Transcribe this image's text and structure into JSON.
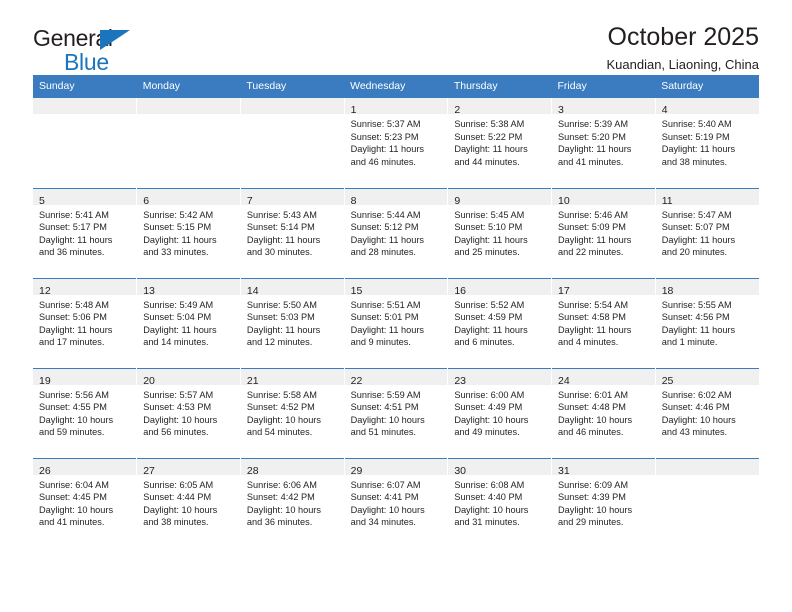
{
  "brand": {
    "line1": "General",
    "line2": "Blue",
    "triangle_color": "#1b75bc"
  },
  "header": {
    "title": "October 2025",
    "subtitle": "Kuandian, Liaoning, China"
  },
  "theme": {
    "header_blue": "#3b7cc0",
    "daynum_band": "#f0f0f0",
    "text": "#231f20",
    "brand_blue": "#1b75bc"
  },
  "weekday_headers": [
    "Sunday",
    "Monday",
    "Tuesday",
    "Wednesday",
    "Thursday",
    "Friday",
    "Saturday"
  ],
  "weeks": [
    [
      {
        "day": "",
        "sunrise": "",
        "sunset": "",
        "daylight_1": "",
        "daylight_2": ""
      },
      {
        "day": "",
        "sunrise": "",
        "sunset": "",
        "daylight_1": "",
        "daylight_2": ""
      },
      {
        "day": "",
        "sunrise": "",
        "sunset": "",
        "daylight_1": "",
        "daylight_2": ""
      },
      {
        "day": "1",
        "sunrise": "Sunrise: 5:37 AM",
        "sunset": "Sunset: 5:23 PM",
        "daylight_1": "Daylight: 11 hours",
        "daylight_2": "and 46 minutes."
      },
      {
        "day": "2",
        "sunrise": "Sunrise: 5:38 AM",
        "sunset": "Sunset: 5:22 PM",
        "daylight_1": "Daylight: 11 hours",
        "daylight_2": "and 44 minutes."
      },
      {
        "day": "3",
        "sunrise": "Sunrise: 5:39 AM",
        "sunset": "Sunset: 5:20 PM",
        "daylight_1": "Daylight: 11 hours",
        "daylight_2": "and 41 minutes."
      },
      {
        "day": "4",
        "sunrise": "Sunrise: 5:40 AM",
        "sunset": "Sunset: 5:19 PM",
        "daylight_1": "Daylight: 11 hours",
        "daylight_2": "and 38 minutes."
      }
    ],
    [
      {
        "day": "5",
        "sunrise": "Sunrise: 5:41 AM",
        "sunset": "Sunset: 5:17 PM",
        "daylight_1": "Daylight: 11 hours",
        "daylight_2": "and 36 minutes."
      },
      {
        "day": "6",
        "sunrise": "Sunrise: 5:42 AM",
        "sunset": "Sunset: 5:15 PM",
        "daylight_1": "Daylight: 11 hours",
        "daylight_2": "and 33 minutes."
      },
      {
        "day": "7",
        "sunrise": "Sunrise: 5:43 AM",
        "sunset": "Sunset: 5:14 PM",
        "daylight_1": "Daylight: 11 hours",
        "daylight_2": "and 30 minutes."
      },
      {
        "day": "8",
        "sunrise": "Sunrise: 5:44 AM",
        "sunset": "Sunset: 5:12 PM",
        "daylight_1": "Daylight: 11 hours",
        "daylight_2": "and 28 minutes."
      },
      {
        "day": "9",
        "sunrise": "Sunrise: 5:45 AM",
        "sunset": "Sunset: 5:10 PM",
        "daylight_1": "Daylight: 11 hours",
        "daylight_2": "and 25 minutes."
      },
      {
        "day": "10",
        "sunrise": "Sunrise: 5:46 AM",
        "sunset": "Sunset: 5:09 PM",
        "daylight_1": "Daylight: 11 hours",
        "daylight_2": "and 22 minutes."
      },
      {
        "day": "11",
        "sunrise": "Sunrise: 5:47 AM",
        "sunset": "Sunset: 5:07 PM",
        "daylight_1": "Daylight: 11 hours",
        "daylight_2": "and 20 minutes."
      }
    ],
    [
      {
        "day": "12",
        "sunrise": "Sunrise: 5:48 AM",
        "sunset": "Sunset: 5:06 PM",
        "daylight_1": "Daylight: 11 hours",
        "daylight_2": "and 17 minutes."
      },
      {
        "day": "13",
        "sunrise": "Sunrise: 5:49 AM",
        "sunset": "Sunset: 5:04 PM",
        "daylight_1": "Daylight: 11 hours",
        "daylight_2": "and 14 minutes."
      },
      {
        "day": "14",
        "sunrise": "Sunrise: 5:50 AM",
        "sunset": "Sunset: 5:03 PM",
        "daylight_1": "Daylight: 11 hours",
        "daylight_2": "and 12 minutes."
      },
      {
        "day": "15",
        "sunrise": "Sunrise: 5:51 AM",
        "sunset": "Sunset: 5:01 PM",
        "daylight_1": "Daylight: 11 hours",
        "daylight_2": "and 9 minutes."
      },
      {
        "day": "16",
        "sunrise": "Sunrise: 5:52 AM",
        "sunset": "Sunset: 4:59 PM",
        "daylight_1": "Daylight: 11 hours",
        "daylight_2": "and 6 minutes."
      },
      {
        "day": "17",
        "sunrise": "Sunrise: 5:54 AM",
        "sunset": "Sunset: 4:58 PM",
        "daylight_1": "Daylight: 11 hours",
        "daylight_2": "and 4 minutes."
      },
      {
        "day": "18",
        "sunrise": "Sunrise: 5:55 AM",
        "sunset": "Sunset: 4:56 PM",
        "daylight_1": "Daylight: 11 hours",
        "daylight_2": "and 1 minute."
      }
    ],
    [
      {
        "day": "19",
        "sunrise": "Sunrise: 5:56 AM",
        "sunset": "Sunset: 4:55 PM",
        "daylight_1": "Daylight: 10 hours",
        "daylight_2": "and 59 minutes."
      },
      {
        "day": "20",
        "sunrise": "Sunrise: 5:57 AM",
        "sunset": "Sunset: 4:53 PM",
        "daylight_1": "Daylight: 10 hours",
        "daylight_2": "and 56 minutes."
      },
      {
        "day": "21",
        "sunrise": "Sunrise: 5:58 AM",
        "sunset": "Sunset: 4:52 PM",
        "daylight_1": "Daylight: 10 hours",
        "daylight_2": "and 54 minutes."
      },
      {
        "day": "22",
        "sunrise": "Sunrise: 5:59 AM",
        "sunset": "Sunset: 4:51 PM",
        "daylight_1": "Daylight: 10 hours",
        "daylight_2": "and 51 minutes."
      },
      {
        "day": "23",
        "sunrise": "Sunrise: 6:00 AM",
        "sunset": "Sunset: 4:49 PM",
        "daylight_1": "Daylight: 10 hours",
        "daylight_2": "and 49 minutes."
      },
      {
        "day": "24",
        "sunrise": "Sunrise: 6:01 AM",
        "sunset": "Sunset: 4:48 PM",
        "daylight_1": "Daylight: 10 hours",
        "daylight_2": "and 46 minutes."
      },
      {
        "day": "25",
        "sunrise": "Sunrise: 6:02 AM",
        "sunset": "Sunset: 4:46 PM",
        "daylight_1": "Daylight: 10 hours",
        "daylight_2": "and 43 minutes."
      }
    ],
    [
      {
        "day": "26",
        "sunrise": "Sunrise: 6:04 AM",
        "sunset": "Sunset: 4:45 PM",
        "daylight_1": "Daylight: 10 hours",
        "daylight_2": "and 41 minutes."
      },
      {
        "day": "27",
        "sunrise": "Sunrise: 6:05 AM",
        "sunset": "Sunset: 4:44 PM",
        "daylight_1": "Daylight: 10 hours",
        "daylight_2": "and 38 minutes."
      },
      {
        "day": "28",
        "sunrise": "Sunrise: 6:06 AM",
        "sunset": "Sunset: 4:42 PM",
        "daylight_1": "Daylight: 10 hours",
        "daylight_2": "and 36 minutes."
      },
      {
        "day": "29",
        "sunrise": "Sunrise: 6:07 AM",
        "sunset": "Sunset: 4:41 PM",
        "daylight_1": "Daylight: 10 hours",
        "daylight_2": "and 34 minutes."
      },
      {
        "day": "30",
        "sunrise": "Sunrise: 6:08 AM",
        "sunset": "Sunset: 4:40 PM",
        "daylight_1": "Daylight: 10 hours",
        "daylight_2": "and 31 minutes."
      },
      {
        "day": "31",
        "sunrise": "Sunrise: 6:09 AM",
        "sunset": "Sunset: 4:39 PM",
        "daylight_1": "Daylight: 10 hours",
        "daylight_2": "and 29 minutes."
      },
      {
        "day": "",
        "sunrise": "",
        "sunset": "",
        "daylight_1": "",
        "daylight_2": ""
      }
    ]
  ]
}
